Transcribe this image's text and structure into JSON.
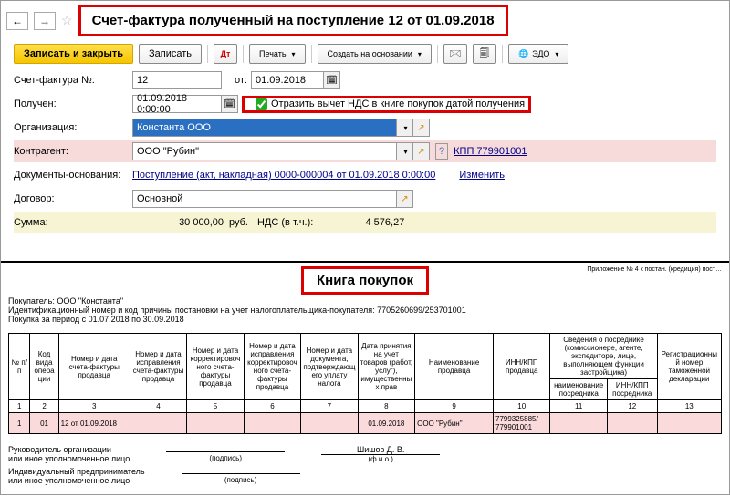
{
  "header": {
    "title": "Счет-фактура полученный на поступление 12 от 01.09.2018"
  },
  "actions": {
    "save_close": "Записать и закрыть",
    "save": "Записать",
    "print": "Печать",
    "create_based": "Создать на основании",
    "edo": "ЭДО"
  },
  "form": {
    "number_label": "Счет-фактура №:",
    "number": "12",
    "from_label": "от:",
    "from": "01.09.2018",
    "received_label": "Получен:",
    "received": "01.09.2018  0:00:00",
    "vat_checkbox_label": "Отразить вычет НДС в книге покупок датой получения",
    "org_label": "Организация:",
    "org": "Константа ООО",
    "contragent_label": "Контрагент:",
    "contragent": "ООО \"Рубин\"",
    "kpp": "КПП 779901001",
    "basis_label": "Документы-основания:",
    "basis_link": "Поступление (акт, накладная) 0000-000004 от 01.09.2018 0:00:00",
    "change": "Изменить",
    "agreement_label": "Договор:",
    "agreement": "Основной",
    "sum_label": "Сумма:",
    "sum": "30 000,00",
    "currency": "руб.",
    "vat_label": "НДС (в т.ч.):",
    "vat": "4 576,27"
  },
  "report": {
    "appendix": "Приложение № 4 к постан. (кредиция) пост…",
    "title": "Книга покупок",
    "buyer_label": "Покупатель:",
    "buyer": "ООО \"Константа\"",
    "ident_label": "Идентификационный номер и код причины постановки на учет налогоплательщика-покупателя:",
    "ident": "7705260699/253701001",
    "period": "Покупка за период с 01.07.2018 по 30.09.2018",
    "headers": {
      "c1": "№ п/п",
      "c2": "Код вида операции",
      "c3": "Номер и дата счета-фактуры продавца",
      "c4": "Номер и дата исправления счета-фактуры продавца",
      "c5": "Номер и дата корректировочного счета-фактуры продавца",
      "c6": "Номер и дата исправления корректировочного счета-фактуры продавца",
      "c7": "Номер и дата документа, подтверждающего уплату налога",
      "c8": "Дата принятия на учет товаров (работ, услуг), имущественных прав",
      "c9": "Наименование продавца",
      "c10": "ИНН/КПП продавца",
      "c_group": "Сведения о посреднике (комиссионере, агенте, экспедиторе, лице, выполняющем функции застройщика)",
      "c11": "наименование посредника",
      "c12": "ИНН/КПП посредника",
      "c13": "Регистрационный номер таможенной декларации"
    },
    "nums": {
      "c1": "1",
      "c2": "2",
      "c3": "3",
      "c4": "4",
      "c5": "5",
      "c6": "6",
      "c7": "7",
      "c8": "8",
      "c9": "9",
      "c10": "10",
      "c11": "11",
      "c12": "12",
      "c13": "13"
    },
    "row": {
      "c1": "1",
      "c2": "01",
      "c3": "12 от 01.09.2018",
      "c8": "01.09.2018",
      "c9": "ООО \"Рубин\"",
      "c10": "7799325885/ 779901001"
    },
    "sign": {
      "head1": "Руководитель организации",
      "head2": "или иное уполномоченное лицо",
      "caption": "(подпись)",
      "name": "Шишов Д. В.",
      "ip1": "Индивидуальный предприниматель",
      "ip2": "или иное уполномоченное лицо"
    }
  }
}
